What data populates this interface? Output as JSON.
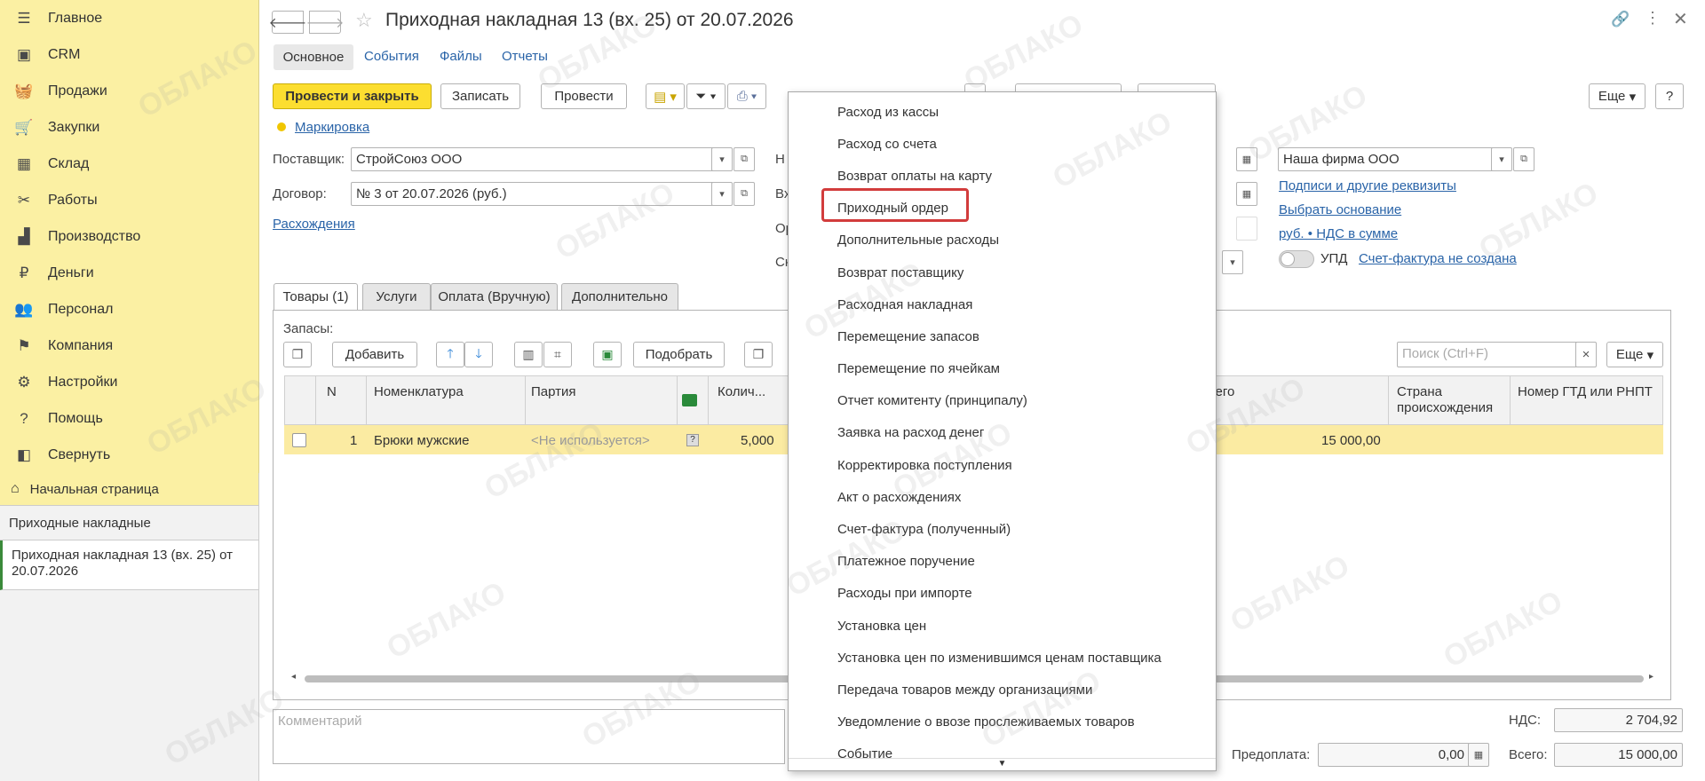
{
  "sidebar": {
    "items": [
      {
        "label": "Главное",
        "icon": "menu-icon"
      },
      {
        "label": "CRM",
        "icon": "crm-icon"
      },
      {
        "label": "Продажи",
        "icon": "basket-icon"
      },
      {
        "label": "Закупки",
        "icon": "cart-icon"
      },
      {
        "label": "Склад",
        "icon": "warehouse-icon"
      },
      {
        "label": "Работы",
        "icon": "tools-icon"
      },
      {
        "label": "Производство",
        "icon": "factory-icon"
      },
      {
        "label": "Деньги",
        "icon": "money-icon"
      },
      {
        "label": "Персонал",
        "icon": "people-icon"
      },
      {
        "label": "Компания",
        "icon": "flag-icon"
      },
      {
        "label": "Настройки",
        "icon": "gear-icon"
      },
      {
        "label": "Помощь",
        "icon": "help-icon"
      },
      {
        "label": "Свернуть",
        "icon": "collapse-icon"
      }
    ],
    "home": "Начальная страница",
    "open_list": "Приходные накладные",
    "open_doc": "Приходная накладная 13 (вх. 25) от 20.07.2026"
  },
  "header": {
    "title": "Приходная накладная 13 (вх. 25) от 20.07.2026",
    "tabs": [
      "Основное",
      "События",
      "Файлы",
      "Отчеты"
    ]
  },
  "toolbar": {
    "post_close": "Провести и закрыть",
    "save": "Записать",
    "post": "Провести",
    "more": "Еще",
    "help": "?"
  },
  "form": {
    "marking": "Маркировка",
    "supplier_label": "Поставщик:",
    "supplier_value": "СтройСоюз ООО",
    "contract_label": "Договор:",
    "contract_value": "№ 3 от 20.07.2026 (руб.)",
    "discrepancies": "Расхождения",
    "org_value": "Наша фирма ООО",
    "signatures": "Подписи и другие реквизиты",
    "choose_basis": "Выбрать основание",
    "vat_mode": "руб. • НДС в сумме",
    "upd": "УПД",
    "invoice_status": "Счет-фактура не создана",
    "hidden_labels": [
      "Н",
      "Вх",
      "Ор",
      "Ск"
    ]
  },
  "grid": {
    "tabs": [
      "Товары (1)",
      "Услуги",
      "Оплата (Вручную)",
      "Дополнительно"
    ],
    "stock_label": "Запасы:",
    "add": "Добавить",
    "pick": "Подобрать",
    "search_placeholder": "Поиск (Ctrl+F)",
    "search_clear": "×",
    "more": "Еще",
    "columns": [
      "N",
      "Номенклатура",
      "Партия",
      "Колич...",
      "сего",
      "Страна происхождения",
      "Номер ГТД или РНПТ"
    ],
    "row": {
      "n": "1",
      "item": "Брюки мужские",
      "batch": "<Не используется>",
      "qty": "5,000",
      "total": "15 000,00"
    }
  },
  "footer": {
    "comment_placeholder": "Комментарий",
    "vat_label": "НДС:",
    "vat_value": "2 704,92",
    "prepay_label": "Предоплата:",
    "prepay_value": "0,00",
    "total_label": "Всего:",
    "total_value": "15 000,00"
  },
  "dropdown": {
    "items": [
      "Расход из кассы",
      "Расход со счета",
      "Возврат оплаты на карту",
      "Приходный ордер",
      "Дополнительные расходы",
      "Возврат поставщику",
      "Расходная накладная",
      "Перемещение запасов",
      "Перемещение по ячейкам",
      "Отчет комитенту (принципалу)",
      "Заявка на расход денег",
      "Корректировка поступления",
      "Акт о расхождениях",
      "Счет-фактура (полученный)",
      "Платежное поручение",
      "Расходы при импорте",
      "Установка цен",
      "Установка цен по изменившимся ценам поставщика",
      "Передача товаров между организациями",
      "Уведомление о ввозе прослеживаемых товаров",
      "Событие"
    ],
    "highlighted": "Приходный ордер"
  },
  "watermark": "ОБЛАКО"
}
